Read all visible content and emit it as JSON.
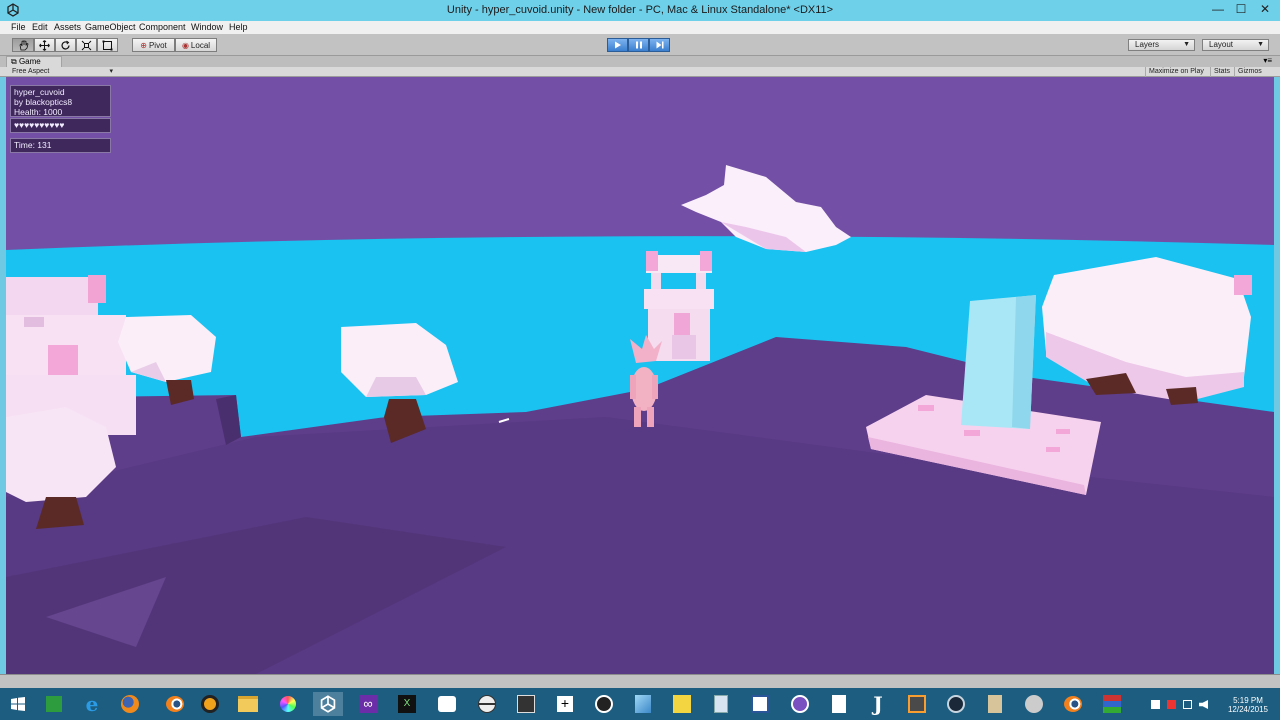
{
  "window": {
    "title": "Unity - hyper_cuvoid.unity - New folder - PC, Mac & Linux Standalone* <DX11>",
    "minimize": "—",
    "maximize": "☐",
    "close": "✕"
  },
  "menu": [
    "File",
    "Edit",
    "Assets",
    "GameObject",
    "Component",
    "Window",
    "Help"
  ],
  "toolbar": {
    "pivot": "Pivot",
    "local": "Local",
    "layers": "Layers",
    "layout": "Layout"
  },
  "game_panel": {
    "tab": "Game",
    "aspect": "Free Aspect",
    "maximize_on_play": "Maximize on Play",
    "stats": "Stats",
    "gizmos": "Gizmos"
  },
  "hud": {
    "name": "hyper_cuvoid",
    "author": "by blackoptics8",
    "health": "Health: 1000",
    "hearts": "♥♥♥♥♥♥♥♥♥♥",
    "time": "Time: 131"
  },
  "taskbar": {
    "time": "5:19 PM",
    "date": "12/24/2015",
    "apps": [
      "start",
      "windows-store",
      "internet-explorer",
      "firefox",
      "blender",
      "headphones",
      "file-explorer",
      "pinwheel",
      "unity",
      "visual-studio",
      "xna",
      "chat",
      "globe",
      "game",
      "plus",
      "web",
      "paint",
      "sticky-note",
      "document",
      "word",
      "discord",
      "file",
      "j-app",
      "sublime-text",
      "steam",
      "notepad",
      "mixer",
      "blender-2",
      "archive"
    ],
    "active_app": "unity"
  },
  "colors": {
    "sky": "#7350a6",
    "water": "#19c2f0",
    "ground": "#5e3d8a",
    "trees": "#f6e4f4",
    "trunks": "#5b2a26",
    "titlebar": "#6fd0ea",
    "taskbar": "#1c5d80"
  }
}
